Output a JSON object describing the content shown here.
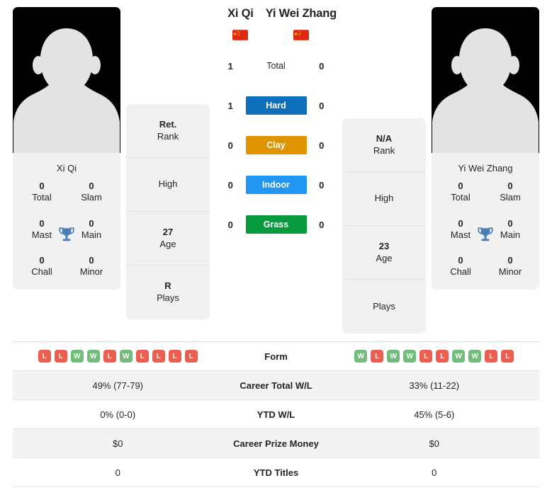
{
  "left_player": {
    "name": "Xi Qi",
    "flag": "china-flag",
    "card_name": "Xi Qi",
    "titles": [
      {
        "value": "0",
        "label": "Total"
      },
      {
        "value": "0",
        "label": "Slam"
      },
      {
        "value": "0",
        "label": "Mast"
      },
      {
        "value": "0",
        "label": "Main"
      },
      {
        "value": "0",
        "label": "Chall"
      },
      {
        "value": "0",
        "label": "Minor"
      }
    ],
    "info": [
      {
        "value": "Ret.",
        "label": "Rank"
      },
      {
        "value": "",
        "label": "High"
      },
      {
        "value": "27",
        "label": "Age"
      },
      {
        "value": "R",
        "label": "Plays"
      }
    ]
  },
  "right_player": {
    "name": "Yi Wei Zhang",
    "flag": "china-flag",
    "card_name": "Yi Wei Zhang",
    "titles": [
      {
        "value": "0",
        "label": "Total"
      },
      {
        "value": "0",
        "label": "Slam"
      },
      {
        "value": "0",
        "label": "Mast"
      },
      {
        "value": "0",
        "label": "Main"
      },
      {
        "value": "0",
        "label": "Chall"
      },
      {
        "value": "0",
        "label": "Minor"
      }
    ],
    "info": [
      {
        "value": "N/A",
        "label": "Rank"
      },
      {
        "value": "",
        "label": "High"
      },
      {
        "value": "23",
        "label": "Age"
      },
      {
        "value": "",
        "label": "Plays"
      }
    ]
  },
  "h2h": [
    {
      "label": "Total",
      "left": "1",
      "right": "0",
      "color": "",
      "style": "plain"
    },
    {
      "label": "Hard",
      "left": "1",
      "right": "0",
      "color": "#0d6eba",
      "style": "chip"
    },
    {
      "label": "Clay",
      "left": "0",
      "right": "0",
      "color": "#e09400",
      "style": "chip"
    },
    {
      "label": "Indoor",
      "left": "0",
      "right": "0",
      "color": "#2196f3",
      "style": "chip"
    },
    {
      "label": "Grass",
      "left": "0",
      "right": "0",
      "color": "#069a3c",
      "style": "chip"
    }
  ],
  "stats_table": [
    {
      "label": "Form",
      "type": "form",
      "left_form": [
        "L",
        "L",
        "W",
        "W",
        "L",
        "W",
        "L",
        "L",
        "L",
        "L"
      ],
      "right_form": [
        "W",
        "L",
        "W",
        "W",
        "L",
        "L",
        "W",
        "W",
        "L",
        "L"
      ]
    },
    {
      "label": "Career Total W/L",
      "type": "text",
      "left": "49% (77-79)",
      "right": "33% (11-22)"
    },
    {
      "label": "YTD W/L",
      "type": "text",
      "left": "0% (0-0)",
      "right": "45% (5-6)"
    },
    {
      "label": "Career Prize Money",
      "type": "text",
      "left": "$0",
      "right": "$0"
    },
    {
      "label": "YTD Titles",
      "type": "text",
      "left": "0",
      "right": "0"
    }
  ],
  "colors": {
    "hard": "#0d6eba",
    "clay": "#e09400",
    "indoor": "#2196f3",
    "grass": "#069a3c",
    "win_badge": "#73bd7c",
    "loss_badge": "#ec5e4f",
    "trophy": "#4a7fb5",
    "card_bg": "#f1f1f1",
    "row_alt_bg": "#f3f3f3"
  }
}
